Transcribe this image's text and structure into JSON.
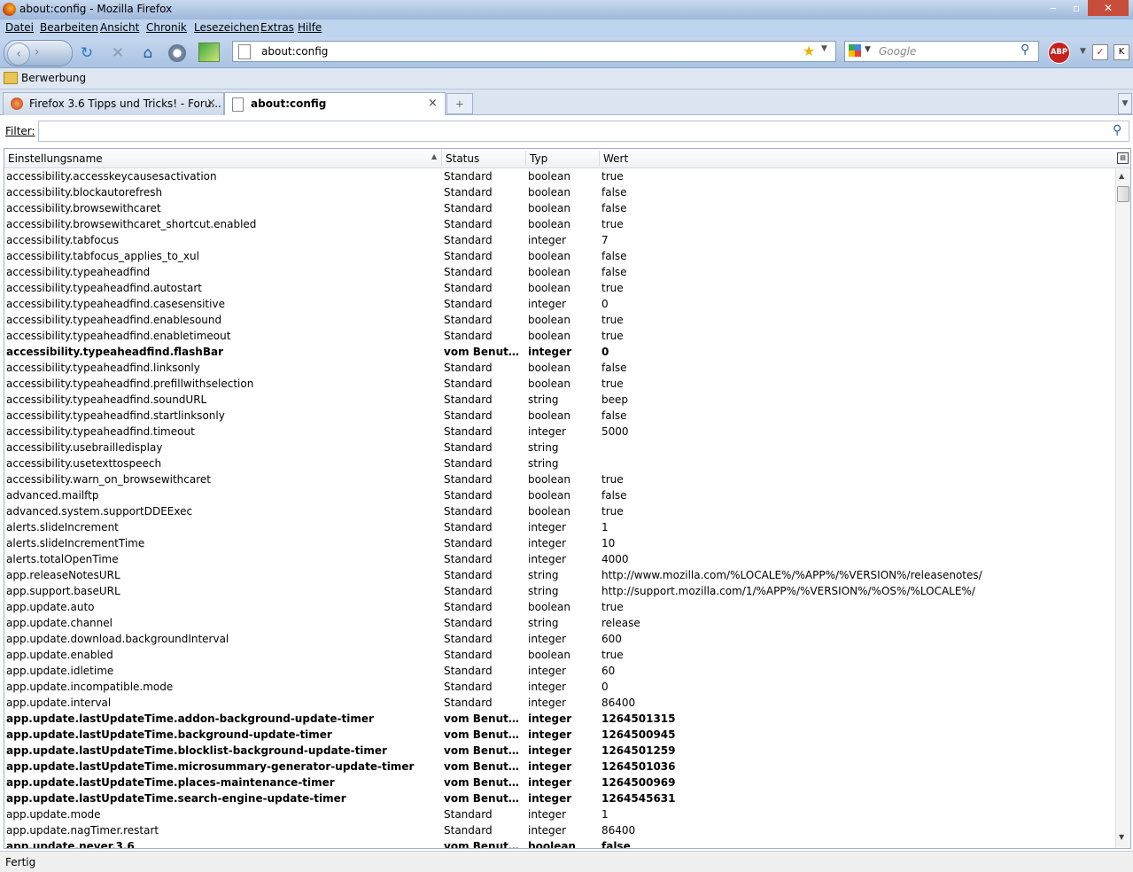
{
  "window": {
    "title": "about:config - Mozilla Firefox",
    "min": "‒",
    "max": "▫",
    "close": "✕"
  },
  "menu": [
    "Datei",
    "Bearbeiten",
    "Ansicht",
    "Chronik",
    "Lesezeichen",
    "Extras",
    "Hilfe"
  ],
  "nav": {
    "url": "about:config",
    "search_placeholder": "Google",
    "back": "‹",
    "forward": "›",
    "reload": "↻",
    "stop": "✕",
    "home": "⌂",
    "abp": "ABP"
  },
  "bookmarks": {
    "item": "Berwerbung"
  },
  "tabs": [
    {
      "label": "Firefox 3.6 Tipps und Tricks! - Foru...",
      "close": "×"
    },
    {
      "label": "about:config",
      "close": "×"
    }
  ],
  "newtab": "+",
  "filter": {
    "label": "Filter:",
    "value": ""
  },
  "columns": {
    "name": "Einstellungsname",
    "status": "Status",
    "type": "Typ",
    "value": "Wert"
  },
  "rows": [
    {
      "name": "accessibility.accesskeycausesactivation",
      "status": "Standard",
      "type": "boolean",
      "value": "true",
      "user": false
    },
    {
      "name": "accessibility.blockautorefresh",
      "status": "Standard",
      "type": "boolean",
      "value": "false",
      "user": false
    },
    {
      "name": "accessibility.browsewithcaret",
      "status": "Standard",
      "type": "boolean",
      "value": "false",
      "user": false
    },
    {
      "name": "accessibility.browsewithcaret_shortcut.enabled",
      "status": "Standard",
      "type": "boolean",
      "value": "true",
      "user": false
    },
    {
      "name": "accessibility.tabfocus",
      "status": "Standard",
      "type": "integer",
      "value": "7",
      "user": false
    },
    {
      "name": "accessibility.tabfocus_applies_to_xul",
      "status": "Standard",
      "type": "boolean",
      "value": "false",
      "user": false
    },
    {
      "name": "accessibility.typeaheadfind",
      "status": "Standard",
      "type": "boolean",
      "value": "false",
      "user": false
    },
    {
      "name": "accessibility.typeaheadfind.autostart",
      "status": "Standard",
      "type": "boolean",
      "value": "true",
      "user": false
    },
    {
      "name": "accessibility.typeaheadfind.casesensitive",
      "status": "Standard",
      "type": "integer",
      "value": "0",
      "user": false
    },
    {
      "name": "accessibility.typeaheadfind.enablesound",
      "status": "Standard",
      "type": "boolean",
      "value": "true",
      "user": false
    },
    {
      "name": "accessibility.typeaheadfind.enabletimeout",
      "status": "Standard",
      "type": "boolean",
      "value": "true",
      "user": false
    },
    {
      "name": "accessibility.typeaheadfind.flashBar",
      "status": "vom Benutze...",
      "type": "integer",
      "value": "0",
      "user": true
    },
    {
      "name": "accessibility.typeaheadfind.linksonly",
      "status": "Standard",
      "type": "boolean",
      "value": "false",
      "user": false
    },
    {
      "name": "accessibility.typeaheadfind.prefillwithselection",
      "status": "Standard",
      "type": "boolean",
      "value": "true",
      "user": false
    },
    {
      "name": "accessibility.typeaheadfind.soundURL",
      "status": "Standard",
      "type": "string",
      "value": "beep",
      "user": false
    },
    {
      "name": "accessibility.typeaheadfind.startlinksonly",
      "status": "Standard",
      "type": "boolean",
      "value": "false",
      "user": false
    },
    {
      "name": "accessibility.typeaheadfind.timeout",
      "status": "Standard",
      "type": "integer",
      "value": "5000",
      "user": false
    },
    {
      "name": "accessibility.usebrailledisplay",
      "status": "Standard",
      "type": "string",
      "value": "",
      "user": false
    },
    {
      "name": "accessibility.usetexttospeech",
      "status": "Standard",
      "type": "string",
      "value": "",
      "user": false
    },
    {
      "name": "accessibility.warn_on_browsewithcaret",
      "status": "Standard",
      "type": "boolean",
      "value": "true",
      "user": false
    },
    {
      "name": "advanced.mailftp",
      "status": "Standard",
      "type": "boolean",
      "value": "false",
      "user": false
    },
    {
      "name": "advanced.system.supportDDEExec",
      "status": "Standard",
      "type": "boolean",
      "value": "true",
      "user": false
    },
    {
      "name": "alerts.slideIncrement",
      "status": "Standard",
      "type": "integer",
      "value": "1",
      "user": false
    },
    {
      "name": "alerts.slideIncrementTime",
      "status": "Standard",
      "type": "integer",
      "value": "10",
      "user": false
    },
    {
      "name": "alerts.totalOpenTime",
      "status": "Standard",
      "type": "integer",
      "value": "4000",
      "user": false
    },
    {
      "name": "app.releaseNotesURL",
      "status": "Standard",
      "type": "string",
      "value": "http://www.mozilla.com/%LOCALE%/%APP%/%VERSION%/releasenotes/",
      "user": false
    },
    {
      "name": "app.support.baseURL",
      "status": "Standard",
      "type": "string",
      "value": "http://support.mozilla.com/1/%APP%/%VERSION%/%OS%/%LOCALE%/",
      "user": false
    },
    {
      "name": "app.update.auto",
      "status": "Standard",
      "type": "boolean",
      "value": "true",
      "user": false
    },
    {
      "name": "app.update.channel",
      "status": "Standard",
      "type": "string",
      "value": "release",
      "user": false
    },
    {
      "name": "app.update.download.backgroundInterval",
      "status": "Standard",
      "type": "integer",
      "value": "600",
      "user": false
    },
    {
      "name": "app.update.enabled",
      "status": "Standard",
      "type": "boolean",
      "value": "true",
      "user": false
    },
    {
      "name": "app.update.idletime",
      "status": "Standard",
      "type": "integer",
      "value": "60",
      "user": false
    },
    {
      "name": "app.update.incompatible.mode",
      "status": "Standard",
      "type": "integer",
      "value": "0",
      "user": false
    },
    {
      "name": "app.update.interval",
      "status": "Standard",
      "type": "integer",
      "value": "86400",
      "user": false
    },
    {
      "name": "app.update.lastUpdateTime.addon-background-update-timer",
      "status": "vom Benutze...",
      "type": "integer",
      "value": "1264501315",
      "user": true
    },
    {
      "name": "app.update.lastUpdateTime.background-update-timer",
      "status": "vom Benutze...",
      "type": "integer",
      "value": "1264500945",
      "user": true
    },
    {
      "name": "app.update.lastUpdateTime.blocklist-background-update-timer",
      "status": "vom Benutze...",
      "type": "integer",
      "value": "1264501259",
      "user": true
    },
    {
      "name": "app.update.lastUpdateTime.microsummary-generator-update-timer",
      "status": "vom Benutze...",
      "type": "integer",
      "value": "1264501036",
      "user": true
    },
    {
      "name": "app.update.lastUpdateTime.places-maintenance-timer",
      "status": "vom Benutze...",
      "type": "integer",
      "value": "1264500969",
      "user": true
    },
    {
      "name": "app.update.lastUpdateTime.search-engine-update-timer",
      "status": "vom Benutze...",
      "type": "integer",
      "value": "1264545631",
      "user": true
    },
    {
      "name": "app.update.mode",
      "status": "Standard",
      "type": "integer",
      "value": "1",
      "user": false
    },
    {
      "name": "app.update.nagTimer.restart",
      "status": "Standard",
      "type": "integer",
      "value": "86400",
      "user": false
    },
    {
      "name": "app.update.never.3.6",
      "status": "vom Benutze...",
      "type": "boolean",
      "value": "false",
      "user": true
    }
  ],
  "status": {
    "text": "Fertig"
  }
}
